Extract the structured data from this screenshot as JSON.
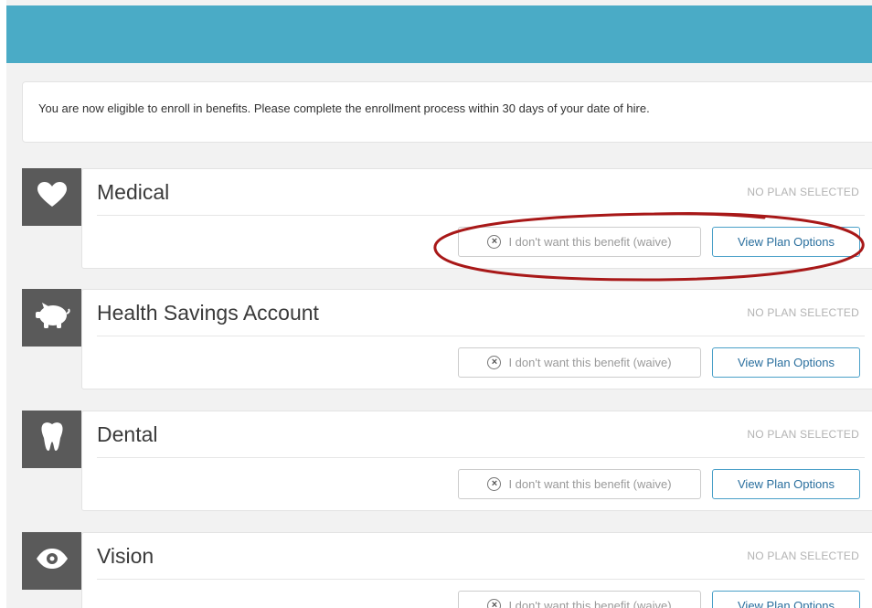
{
  "notice": {
    "text": "You are now eligible to enroll in benefits. Please complete the enrollment process within 30 days of your date of hire."
  },
  "benefits": [
    {
      "title": "Medical",
      "icon": "heart-icon",
      "status": "NO PLAN SELECTED",
      "waive_label": "I don't want this benefit (waive)",
      "view_label": "View Plan Options"
    },
    {
      "title": "Health Savings Account",
      "icon": "piggy-bank-icon",
      "status": "NO PLAN SELECTED",
      "waive_label": "I don't want this benefit (waive)",
      "view_label": "View Plan Options"
    },
    {
      "title": "Dental",
      "icon": "tooth-icon",
      "status": "NO PLAN SELECTED",
      "waive_label": "I don't want this benefit (waive)",
      "view_label": "View Plan Options"
    },
    {
      "title": "Vision",
      "icon": "eye-icon",
      "status": "NO PLAN SELECTED",
      "waive_label": "I don't want this benefit (waive)",
      "view_label": "View Plan Options"
    }
  ],
  "colors": {
    "header": "#4aabc6",
    "icon_tile": "#5a5a5a",
    "button_border": "#4aa0c8",
    "annotation": "#a81818"
  }
}
